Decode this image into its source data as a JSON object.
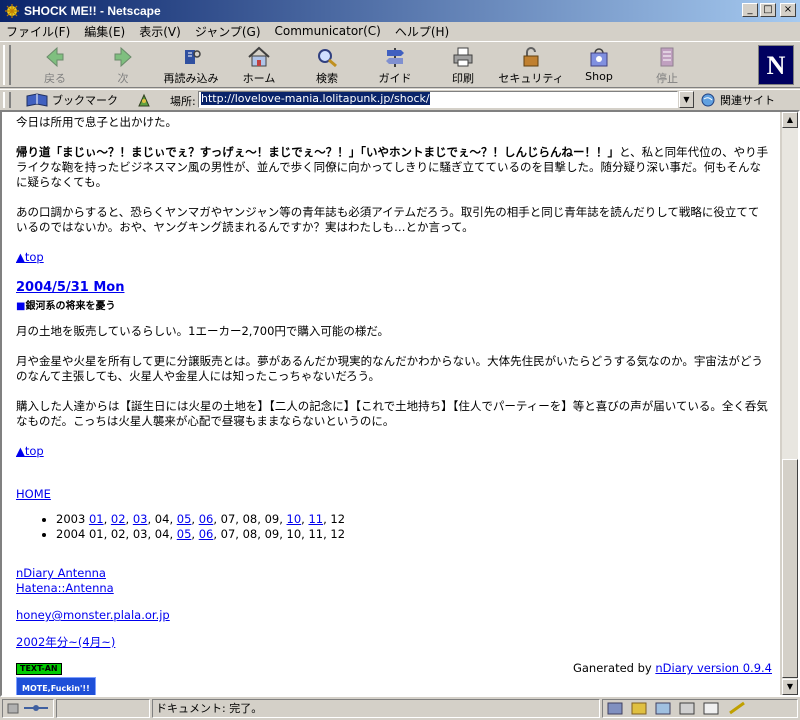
{
  "window": {
    "title": "SHOCK ME!! - Netscape",
    "buttons": [
      "_",
      "□",
      "×"
    ]
  },
  "menu": [
    "ファイル(F)",
    "編集(E)",
    "表示(V)",
    "ジャンプ(G)",
    "Communicator(C)",
    "ヘルプ(H)"
  ],
  "toolbar": {
    "back": "戻る",
    "forward": "次",
    "reload": "再読み込み",
    "home": "ホーム",
    "search": "検索",
    "guide": "ガイド",
    "print": "印刷",
    "security": "セキュリティ",
    "shop": "Shop",
    "stop": "停止",
    "logo": "N"
  },
  "location": {
    "bookmark": "ブックマーク",
    "label": "場所:",
    "url": "http://lovelove-mania.lolitapunk.jp/shock/",
    "related": "関連サイト"
  },
  "content": {
    "p1": "今日は所用で息子と出かけた。",
    "p2_bold": "帰り道「まじぃ〜？！まじぃでぇ？すっげぇ〜！まじでぇ〜？！」「いやホントまじでぇ〜？！しんじらんねー！！」",
    "p2_rest": "と、私と同年代位の、やり手ライクな鞄を持ったビジネスマン風の男性が、並んで歩く同僚に向かってしきりに騒ぎ立てているのを目撃した。随分疑り深い事だ。何もそんなに疑らなくても。",
    "p3": "あの口調からすると、恐らくヤンマガやヤンジャン等の青年誌も必須アイテムだろう。取引先の相手と同じ青年誌を読んだりして戦略に役立てているのではないか。おや、ヤングキング読まれるんですか？実はわたしも…とか言って。",
    "top1": "▲top",
    "date": "2004/5/31 Mon",
    "section_mark": "■",
    "section_title": "銀河系の将来を憂う",
    "p4": "月の土地を販売しているらしい。1エーカー2,700円で購入可能の様だ。",
    "p5": "月や金星や火星を所有して更に分譲販売とは。夢があるんだか現実的なんだかわからない。大体先住民がいたらどうする気なのか。宇宙法がどうのなんて主張しても、火星人や金星人には知ったこっちゃないだろう。",
    "p6": "購入した人達からは【誕生日には火星の土地を】【二人の記念に】【これで土地持ち】【住人でパーティーを】等と喜びの声が届いている。全く呑気なものだ。こっちは火星人襲来が心配で昼寝もままならないというのに。",
    "top2": "▲top",
    "home": "HOME",
    "year2003": "2003",
    "year2004": "2004",
    "months_2003": [
      {
        "m": "01",
        "link": true
      },
      {
        "m": "02",
        "link": true
      },
      {
        "m": "03",
        "link": true
      },
      {
        "m": "04",
        "link": false
      },
      {
        "m": "05",
        "link": true
      },
      {
        "m": "06",
        "link": true
      },
      {
        "m": "07",
        "link": false
      },
      {
        "m": "08",
        "link": false
      },
      {
        "m": "09",
        "link": false
      },
      {
        "m": "10",
        "link": true
      },
      {
        "m": "11",
        "link": true
      },
      {
        "m": "12",
        "link": false
      }
    ],
    "months_2004": [
      {
        "m": "01",
        "link": false
      },
      {
        "m": "02",
        "link": false
      },
      {
        "m": "03",
        "link": false
      },
      {
        "m": "04",
        "link": false
      },
      {
        "m": "05",
        "link": true
      },
      {
        "m": "06",
        "link": true
      },
      {
        "m": "07",
        "link": false
      },
      {
        "m": "08",
        "link": false
      },
      {
        "m": "09",
        "link": false
      },
      {
        "m": "10",
        "link": false
      },
      {
        "m": "11",
        "link": false
      },
      {
        "m": "12",
        "link": false
      }
    ],
    "antenna": "nDiary Antenna",
    "hatena": "Hatena::Antenna",
    "email": "honey@monster.plala.or.jp",
    "archive": "2002年分~(4月~)",
    "badge1": "TEXT-AN",
    "badge2": "MOTE,Fuckin'!!",
    "generated_prefix": "Ganerated by ",
    "generated_link": "nDiary version 0.9.4"
  },
  "status": {
    "text": "ドキュメント: 完了。"
  }
}
